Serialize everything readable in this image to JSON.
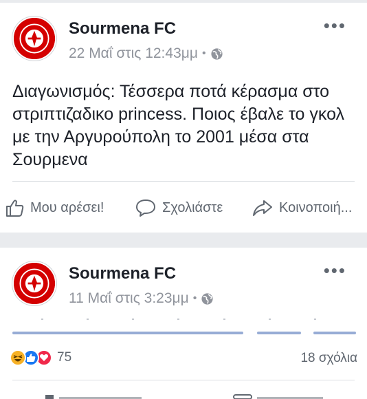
{
  "posts": [
    {
      "page_name": "Sourmena FC",
      "timestamp": "22 Μαΐ στις 12:43μμ",
      "privacy_icon": "globe-icon",
      "text": "Διαγωνισμός: Τέσσερα ποτά κέρασμα στο στριπτιζαδικο princess.  Ποιος έβαλε το γκολ με την Αργυρούπολη το 2001 μέσα στα Σουρμενα",
      "actions": {
        "like": "Μου αρέσει!",
        "comment": "Σχολιάστε",
        "share": "Κοινοποιή..."
      }
    },
    {
      "page_name": "Sourmena FC",
      "timestamp": "11 Μαΐ στις 3:23μμ",
      "privacy_icon": "globe-icon",
      "reactions_count": "75",
      "comments_count": "18 σχόλια",
      "reaction_icons": [
        "haha-reaction-icon",
        "like-reaction-icon",
        "love-reaction-icon"
      ]
    }
  ],
  "colors": {
    "brand_blue": "#4267b2",
    "avatar_red": "#d40000",
    "meta_gray": "#90949c",
    "action_gray": "#606770"
  }
}
